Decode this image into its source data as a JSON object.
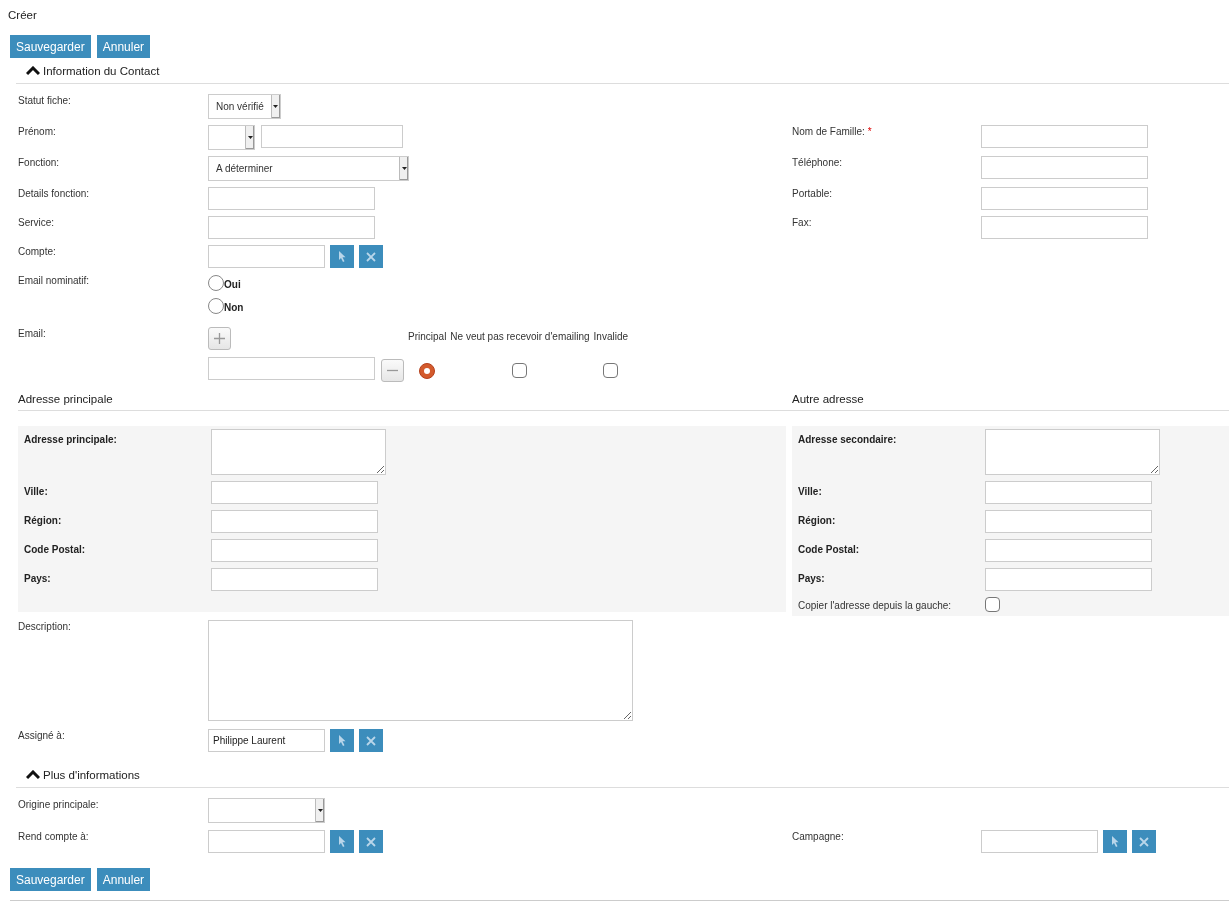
{
  "page_title": "Créer",
  "top_buttons": [
    {
      "label": "Sauvegarder"
    },
    {
      "label": "Annuler"
    }
  ],
  "contact_panel": {
    "title": "Information du Contact",
    "expanded": true,
    "rows": [
      {
        "left": {
          "kind": "compact_select",
          "label": "Statut fiche:",
          "value": "Non vérifié"
        }
      },
      {
        "left": {
          "kind": "name",
          "label": "Prénom:"
        },
        "right": {
          "kind": "text",
          "label": "Nom de Famille:",
          "required_mark": "*"
        }
      },
      {
        "left": {
          "kind": "select",
          "label": "Fonction:",
          "value": "A déterminer"
        },
        "right": {
          "kind": "text",
          "label": "Téléphone:"
        }
      },
      {
        "left": {
          "kind": "text",
          "label": "Details fonction:"
        },
        "right": {
          "kind": "text",
          "label": "Portable:"
        }
      },
      {
        "left": {
          "kind": "text",
          "label": "Service:"
        },
        "right": {
          "kind": "text",
          "label": "Fax:"
        }
      },
      {
        "left": {
          "kind": "relate",
          "label": "Compte:"
        }
      },
      {
        "left": {
          "kind": "radio_group",
          "label": "Email nominatif:",
          "options": [
            {
              "label": "Oui",
              "selected": false
            },
            {
              "label": "Non",
              "selected": false
            }
          ]
        }
      },
      {
        "left": {
          "kind": "email",
          "label": "Email:",
          "columns": [
            "Principal",
            "Ne veut pas recevoir d'emailing",
            "Invalide"
          ],
          "entries": [
            {
              "primary": true,
              "opt_out": false,
              "invalid": false
            }
          ]
        }
      }
    ],
    "addresses": [
      {
        "title": "Adresse principale",
        "fields": [
          {
            "kind": "textarea",
            "label": "Adresse principale:"
          },
          {
            "kind": "text",
            "label": "Ville:"
          },
          {
            "kind": "text",
            "label": "Région:"
          },
          {
            "kind": "text",
            "label": "Code Postal:"
          },
          {
            "kind": "text",
            "label": "Pays:"
          }
        ]
      },
      {
        "title": "Autre adresse",
        "fields": [
          {
            "kind": "textarea",
            "label": "Adresse secondaire:"
          },
          {
            "kind": "text",
            "label": "Ville:"
          },
          {
            "kind": "text",
            "label": "Région:"
          },
          {
            "kind": "text",
            "label": "Code Postal:"
          },
          {
            "kind": "text",
            "label": "Pays:"
          },
          {
            "kind": "checkbox",
            "label": "Copier l'adresse depuis la gauche:",
            "checked": false
          }
        ]
      }
    ],
    "detail_rows": [
      {
        "left": {
          "kind": "textarea_large",
          "label": "Description:"
        }
      },
      {
        "left": {
          "kind": "relate",
          "label": "Assigné à:",
          "value": "Philippe Laurent"
        }
      }
    ]
  },
  "more_panel": {
    "title": "Plus d'informations",
    "expanded": true,
    "rows": [
      {
        "left": {
          "kind": "short_select",
          "label": "Origine principale:"
        }
      },
      {
        "left": {
          "kind": "relate",
          "label": "Rend compte à:"
        },
        "right": {
          "kind": "relate",
          "label": "Campagne:"
        }
      }
    ]
  },
  "bottom_buttons": [
    {
      "label": "Sauvegarder"
    },
    {
      "label": "Annuler"
    }
  ]
}
